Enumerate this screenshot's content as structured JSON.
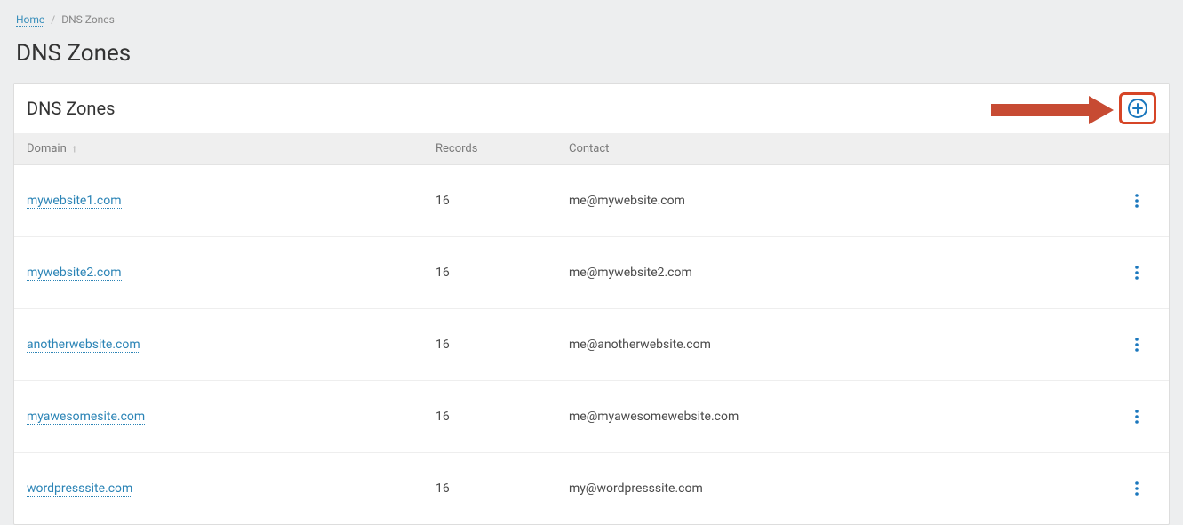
{
  "breadcrumb": {
    "home": "Home",
    "current": "DNS Zones"
  },
  "page": {
    "title": "DNS Zones"
  },
  "panel": {
    "title": "DNS Zones",
    "columns": {
      "domain": "Domain",
      "sort_indicator": "↑",
      "records": "Records",
      "contact": "Contact"
    },
    "rows": [
      {
        "domain": "mywebsite1.com",
        "records": "16",
        "contact": "me@mywebsite.com"
      },
      {
        "domain": "mywebsite2.com",
        "records": "16",
        "contact": "me@mywebsite2.com"
      },
      {
        "domain": "anotherwebsite.com",
        "records": "16",
        "contact": "me@anotherwebsite.com"
      },
      {
        "domain": "myawesomesite.com",
        "records": "16",
        "contact": "me@myawesomewebsite.com"
      },
      {
        "domain": "wordpresssite.com",
        "records": "16",
        "contact": "my@wordpresssite.com"
      }
    ]
  }
}
